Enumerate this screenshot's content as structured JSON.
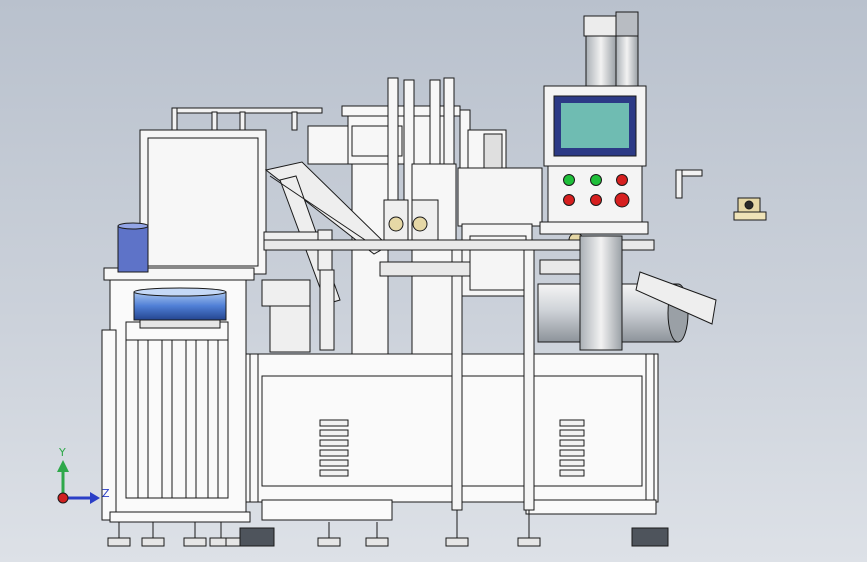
{
  "triad": {
    "y_label": "Y",
    "z_label": "Z"
  },
  "colors": {
    "background_top": "#b9c1cd",
    "panel_screen": "#6fbcb2",
    "panel_frame": "#2c3a86",
    "button_green": "#1fbf3a",
    "button_red": "#d61f1f",
    "triad_y": "#2ea84a",
    "triad_z": "#2b3fc7",
    "triad_origin": "#d02020",
    "tank_blue": "#5c7ad6"
  }
}
